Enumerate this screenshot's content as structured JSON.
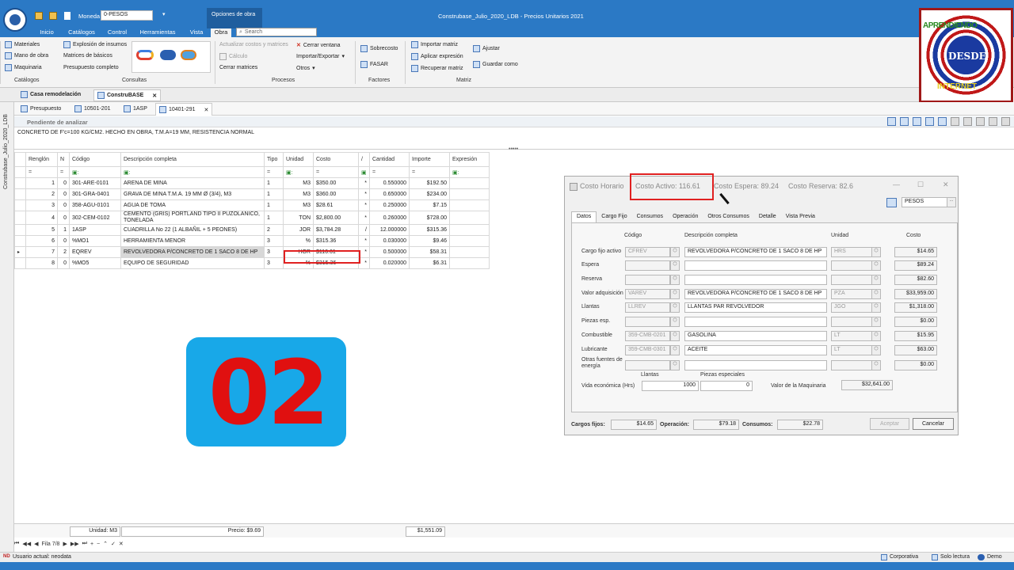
{
  "window": {
    "title": "Construbase_Julio_2020_LDB - Precios Unitarios 2021",
    "moneda_label": "Moneda",
    "moneda_value": "0-PESOS",
    "context_tab": "Opciones de obra",
    "search_placeholder": "Search"
  },
  "menu_tabs": [
    "Inicio",
    "Catálogos",
    "Control",
    "Herramientas",
    "Vista",
    "Obra"
  ],
  "ribbon": {
    "catalogos": {
      "items": [
        "Materiales",
        "Mano de obra",
        "Maquinaria"
      ],
      "label": "Catálogos"
    },
    "consultas": {
      "items": [
        "Explosión de insumos",
        "Matrices de básicos",
        "Presupuesto completo"
      ],
      "label": "Consultas"
    },
    "procesos": {
      "items": [
        "Actualizar costos y matrices",
        "Cálculo",
        "Cerrar matrices",
        "Cerrar ventana",
        "Importar/Exportar",
        "Otros"
      ],
      "label": "Procesos"
    },
    "factores": {
      "items": [
        "Sobrecosto",
        "FASAR"
      ],
      "label": "Factores"
    },
    "matriz": {
      "items": [
        "Importar matriz",
        "Aplicar expresión",
        "Recuperar matriz",
        "Ajustar",
        "Guardar como"
      ],
      "label": "Matriz"
    }
  },
  "doc_tabs": [
    "Casa remodelación",
    "ConstruBASE"
  ],
  "sub_tabs": [
    "Presupuesto",
    "10501-201",
    "1ASP",
    "10401-291"
  ],
  "side_label": "Construbase_Julio_2020_LDB",
  "pending_label": "Pendiente de analizar",
  "description": "CONCRETO DE F'c=100 KG/CM2. HECHO EN OBRA,  T.M.A=19 MM, RESISTENCIA NORMAL",
  "grid": {
    "headers": [
      "Renglón",
      "N",
      "Código",
      "Descripción completa",
      "Tipo",
      "Unidad",
      "Costo",
      "/",
      "Cantidad",
      "Importe",
      "Expresión"
    ],
    "rows": [
      [
        "1",
        "0",
        "301-ARE-0101",
        "ARENA DE MINA",
        "1",
        "M3",
        "$350.00",
        "*",
        "0.550000",
        "$192.50"
      ],
      [
        "2",
        "0",
        "301-GRA-0401",
        "GRAVA DE MINA T.M.A. 19 MM Ø (3/4), M3",
        "1",
        "M3",
        "$360.00",
        "*",
        "0.650000",
        "$234.00"
      ],
      [
        "3",
        "0",
        "358-AGU-0101",
        "AGUA DE TOMA",
        "1",
        "M3",
        "$28.61",
        "*",
        "0.250000",
        "$7.15"
      ],
      [
        "4",
        "0",
        "302-CEM-0102",
        "CEMENTO (GRIS) PORTLAND TIPO II PUZOLANICO, TONELADA",
        "1",
        "TON",
        "$2,800.00",
        "*",
        "0.260000",
        "$728.00"
      ],
      [
        "5",
        "1",
        "1ASP",
        "CUADRILLA No 22  (1 ALBAÑIL + 5 PEONES)",
        "2",
        "JOR",
        "$3,784.28",
        "/",
        "12.000000",
        "$315.36"
      ],
      [
        "6",
        "0",
        "%MO1",
        "HERRAMIENTA MENOR",
        "3",
        "%",
        "$315.36",
        "*",
        "0.030000",
        "$9.46"
      ],
      [
        "7",
        "2",
        "EQREV",
        "REVOLVEDORA P/CONCRETO DE 1 SACO 8 DE HP",
        "3",
        "HOR",
        "$116.61",
        "*",
        "0.500000",
        "$58.31"
      ],
      [
        "8",
        "0",
        "%MO5",
        "EQUIPO DE SEGURIDAD",
        "3",
        "%",
        "$315.36",
        "*",
        "0.020000",
        "$6.31"
      ]
    ],
    "footer_unit": "Unidad: M3",
    "footer_price": "Precio: $9.69",
    "footer_total": "$1,551.09",
    "nav": "Fila 7/8"
  },
  "badge": {
    "text": "02"
  },
  "logo": {
    "top": "APRENDIENDO",
    "middle": "DESDE",
    "bottom": "INTERNET"
  },
  "dialog": {
    "title": "Costo Horario",
    "costo_activo": "Costo Activo: 116.61",
    "costo_espera": "Costo Espera: 89.24",
    "costo_reserva": "Costo Reserva: 82.6",
    "currency": "PESOS",
    "tabs": [
      "Datos",
      "Cargo Fijo",
      "Consumos",
      "Operación",
      "Otros Consumos",
      "Detalle",
      "Vista Previa"
    ],
    "col_headers": [
      "Código",
      "Descripción completa",
      "Unidad",
      "Costo"
    ],
    "rows": [
      {
        "label": "Cargo fijo activo",
        "code": "CFREV",
        "desc": "REVOLVEDORA P/CONCRETO DE 1 SACO 8 DE HP",
        "unit": "HRS",
        "cost": "$14.65"
      },
      {
        "label": "Espera",
        "code": "",
        "desc": "",
        "unit": "",
        "cost": "$89.24"
      },
      {
        "label": "Reserva",
        "code": "",
        "desc": "",
        "unit": "",
        "cost": "$82.60"
      },
      {
        "label": "Valor adquisición",
        "code": "VAREV",
        "desc": "REVOLVEDORA P/CONCRETO DE 1 SACO 8 DE HP",
        "unit": "PZA",
        "cost": "$33,959.00"
      },
      {
        "label": "Llantas",
        "code": "LLREV",
        "desc": "LLANTAS PAR REVOLVEDOR",
        "unit": "JGO",
        "cost": "$1,318.00"
      },
      {
        "label": "Piezas esp.",
        "code": "",
        "desc": "",
        "unit": "",
        "cost": "$0.00"
      },
      {
        "label": "Combustible",
        "code": "359-CMB-0201",
        "desc": "GASOLINA",
        "unit": "LT",
        "cost": "$15.95"
      },
      {
        "label": "Lubricante",
        "code": "359-CMB-0301",
        "desc": "ACEITE",
        "unit": "LT",
        "cost": "$63.00"
      },
      {
        "label": "Otras fuentes de energía",
        "code": "",
        "desc": "",
        "unit": "",
        "cost": "$0.00"
      }
    ],
    "vida_label": "Vida económica (Hrs)",
    "llantas_label": "Llantas",
    "llantas_value": "1000",
    "piezas_label": "Piezas especiales",
    "piezas_value": "0",
    "valor_label": "Valor de la Maquinaria",
    "valor_value": "$32,641.00",
    "cargos_label": "Cargos fijos:",
    "cargos_value": "$14.65",
    "operacion_label": "Operación:",
    "operacion_value": "$79.18",
    "consumos_label": "Consumos:",
    "consumos_value": "$22.78",
    "aceptar": "Aceptar",
    "cancelar": "Cancelar"
  },
  "status": {
    "user": "Usuario actual: neodata",
    "corporativa": "Corporativa",
    "solo_lectura": "Solo lectura",
    "demo": "Demo"
  },
  "colors": {
    "titlebar": "#2b79c5",
    "badge_bg": "#18a8e8",
    "badge_text": "#e01010",
    "highlight": "#e02020",
    "logo_red": "#a01818",
    "logo_blue": "#1a3aa0"
  }
}
